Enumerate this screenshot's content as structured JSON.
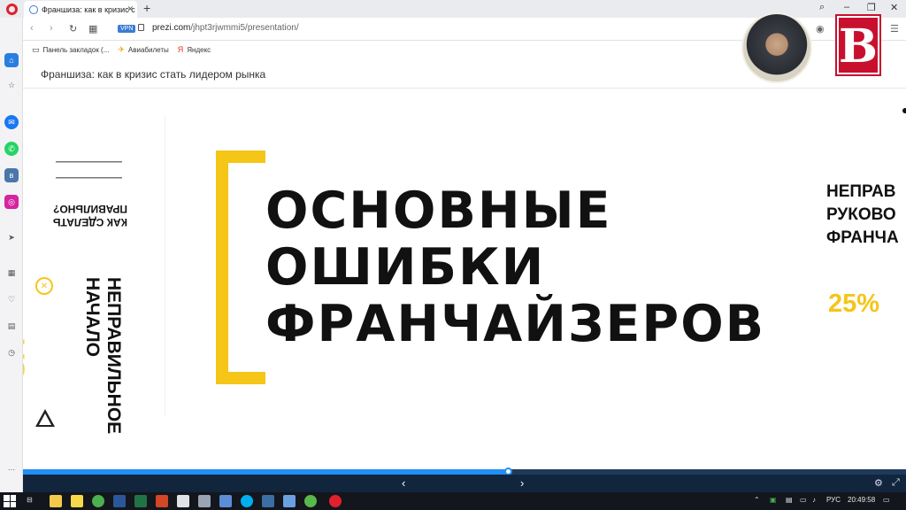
{
  "browser": {
    "tab_title": "Франшиза: как в кризис с",
    "url_domain": "prezi.com",
    "url_path": "/jhpt3rjwmmi5/presentation/",
    "vpn_label": "VPN",
    "bookmarks": [
      "Панель закладок (...",
      "Авиабилеты",
      "Яндекс"
    ]
  },
  "prezi": {
    "title": "Франшиза: как в кризис стать лидером рынка"
  },
  "slide": {
    "title_lines": [
      "ОСНОВНЫЕ",
      "ОШИБКИ",
      "ФРАНЧАЙЗЕРОВ"
    ],
    "left_question_lines": [
      "КАК СДЕЛАТЬ",
      "ПРАВИЛЬНО?"
    ],
    "left_heading_lines": [
      "НЕПРАВИЛЬНОЕ",
      "НАЧАЛО"
    ],
    "vs": "VS",
    "right_lines": [
      "НЕПРАВ",
      "РУКОВО",
      "ФРАНЧА"
    ],
    "percent": "25%"
  },
  "progress": {
    "fraction": 0.55
  },
  "taskbar": {
    "language": "РУС",
    "time": "20:49:58"
  },
  "colors": {
    "accent_yellow": "#f5c518",
    "progress_blue": "#1f8ff5",
    "logo_red": "#c8102e"
  },
  "logo_letter": "B"
}
